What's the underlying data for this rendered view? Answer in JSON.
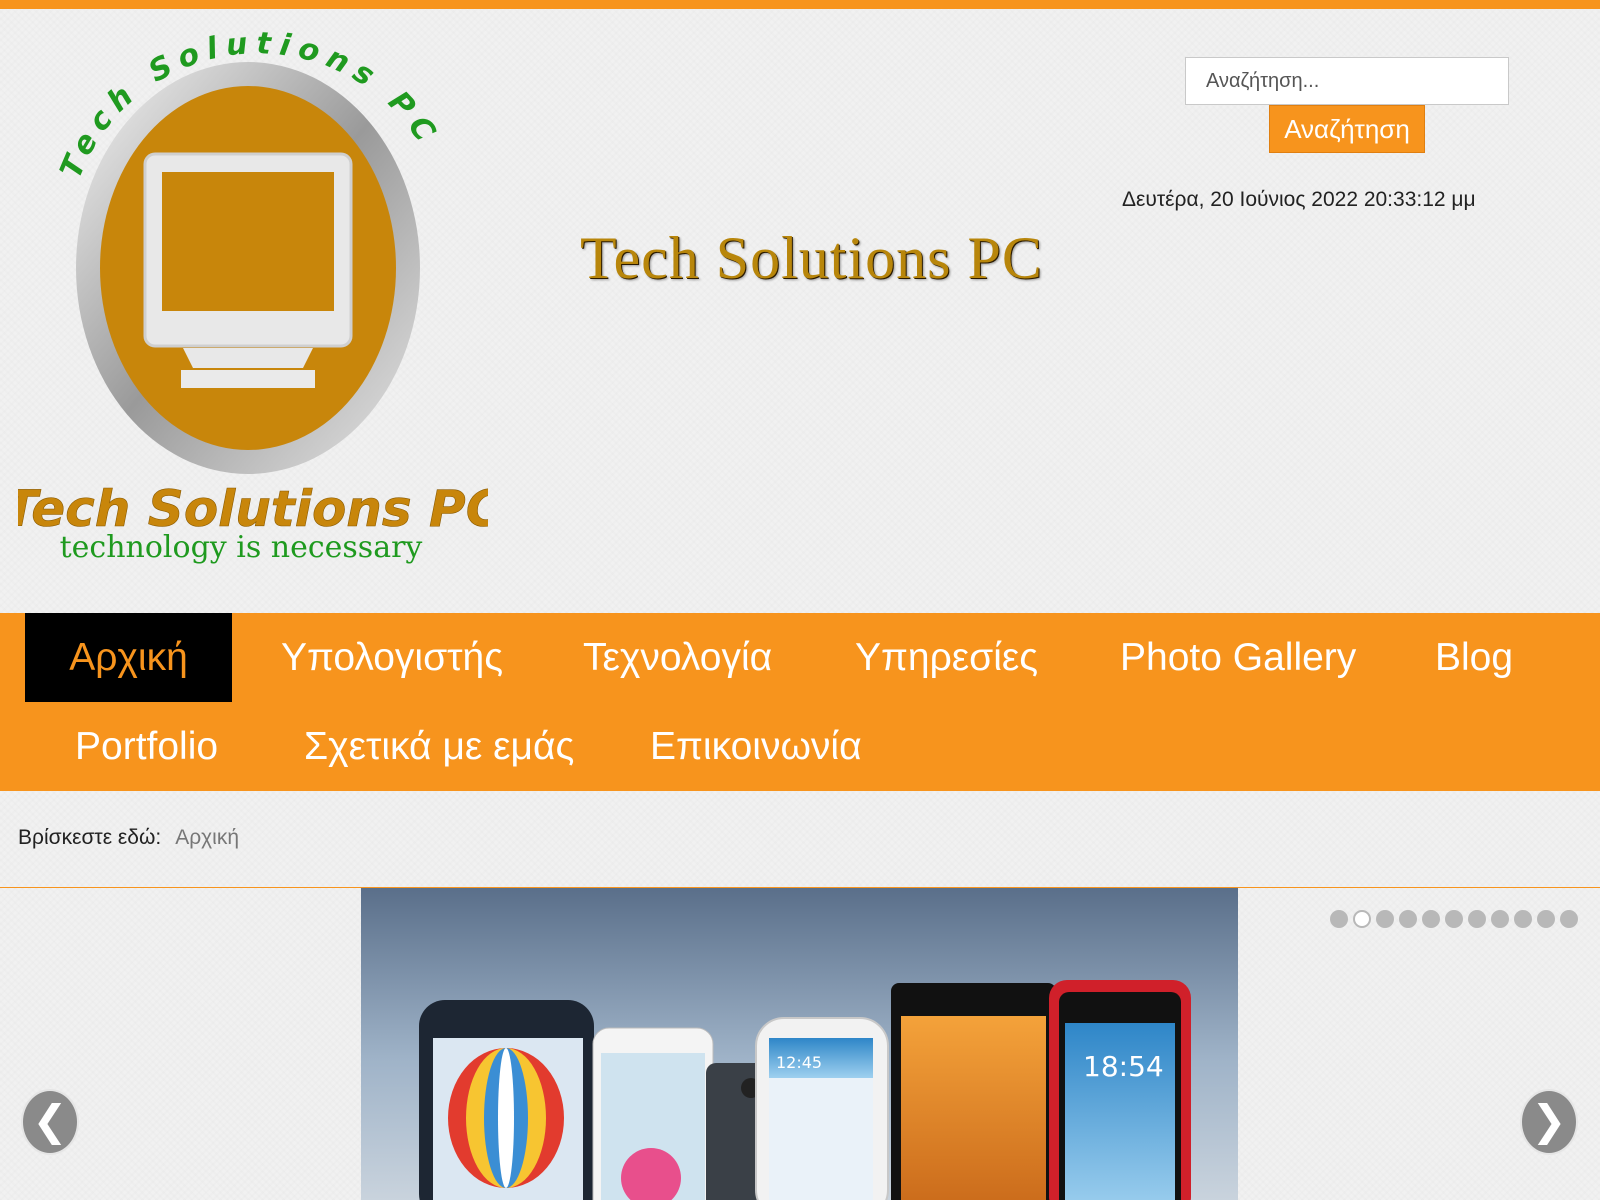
{
  "logo": {
    "arc_text": "Tech Solutions PC",
    "name": "Tech Solutions PC",
    "tagline": "technology is necessary"
  },
  "search": {
    "placeholder": "Αναζήτηση...",
    "button_label": "Αναζήτηση"
  },
  "datetime": "Δευτέρα, 20 Ιούνιος 2022 20:33:12 μμ",
  "site_title": "Tech Solutions PC",
  "nav": {
    "items": [
      {
        "label": "Αρχική",
        "active": true
      },
      {
        "label": "Υπολογιστής"
      },
      {
        "label": "Τεχνολογία"
      },
      {
        "label": "Υπηρεσίες"
      },
      {
        "label": "Photo Gallery"
      },
      {
        "label": "Blog"
      },
      {
        "label": "Portfolio"
      },
      {
        "label": "Σχετικά με εμάς"
      },
      {
        "label": "Επικοινωνία"
      }
    ]
  },
  "breadcrumb": {
    "label": "Βρίσκεστε εδώ:",
    "current": "Αρχική"
  },
  "slider": {
    "dot_count": 11,
    "active_dot": 1,
    "prev_glyph": "❮",
    "next_glyph": "❯",
    "phone_clock_1": "12:45",
    "phone_clock_2": "18:54"
  },
  "colors": {
    "accent": "#f7941d",
    "active_nav_bg": "#000000",
    "logo_gold": "#c8860b",
    "logo_green": "#1f9a1f"
  }
}
